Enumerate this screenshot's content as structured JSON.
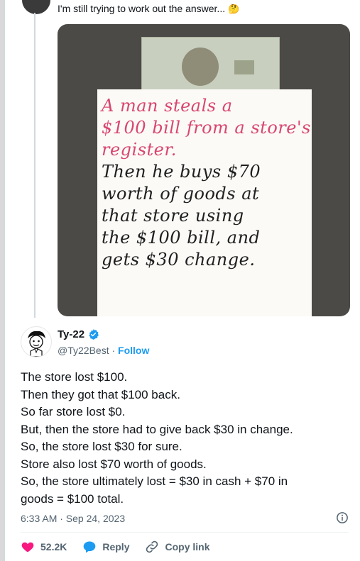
{
  "quoted": {
    "text": "I'm still trying to work out the answer...",
    "emoji": "🤔"
  },
  "image": {
    "lines": [
      {
        "text": "A man steals a",
        "color": "red"
      },
      {
        "text": "$100 bill from a store's",
        "color": "red"
      },
      {
        "text": "register.",
        "color": "red"
      },
      {
        "text": "Then he buys $70",
        "color": "black"
      },
      {
        "text": "worth of goods at",
        "color": "black"
      },
      {
        "text": "that store using",
        "color": "black"
      },
      {
        "text": "the $100 bill, and",
        "color": "black"
      },
      {
        "text": "gets $30 change.",
        "color": "black"
      }
    ]
  },
  "author": {
    "name": "Ty-22",
    "handle": "@Ty22Best",
    "separator": " · ",
    "follow_label": "Follow"
  },
  "tweet": {
    "lines": [
      "The store lost $100.",
      "Then they got that $100 back.",
      "So far store lost $0.",
      "But, then the store had to give back $30 in change.",
      "So, the store lost $30 for sure.",
      "Store also lost $70 worth of goods.",
      "So, the store ultimately lost = $30 in cash + $70 in",
      "goods = $100 total."
    ],
    "timestamp": "6:33 AM · Sep 24, 2023"
  },
  "actions": {
    "likes": "52.2K",
    "reply_label": "Reply",
    "copy_link_label": "Copy link"
  },
  "colors": {
    "accent": "#1d9bf0",
    "like": "#f91880",
    "secondary_text": "#536471"
  }
}
